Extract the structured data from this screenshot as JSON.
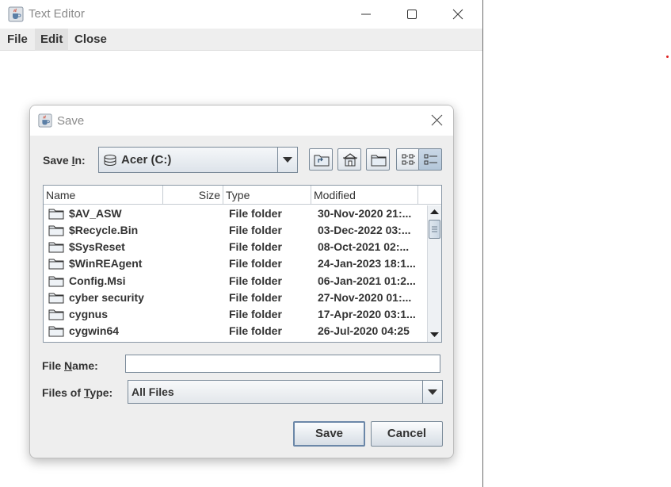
{
  "editor": {
    "title": "Text Editor",
    "menu": {
      "file": "File",
      "edit": "Edit",
      "close": "Close"
    }
  },
  "dialog": {
    "title": "Save",
    "save_in_label_prefix": "Save ",
    "save_in_label_mnemonic": "I",
    "save_in_label_suffix": "n:",
    "save_in_value": "Acer (C:)",
    "columns": {
      "name": "Name",
      "size": "Size",
      "type": "Type",
      "modified": "Modified"
    },
    "files": [
      {
        "name": "$AV_ASW",
        "type": "File folder",
        "modified": "30-Nov-2020 21:..."
      },
      {
        "name": "$Recycle.Bin",
        "type": "File folder",
        "modified": "03-Dec-2022 03:..."
      },
      {
        "name": "$SysReset",
        "type": "File folder",
        "modified": "08-Oct-2021 02:..."
      },
      {
        "name": "$WinREAgent",
        "type": "File folder",
        "modified": "24-Jan-2023 18:1..."
      },
      {
        "name": "Config.Msi",
        "type": "File folder",
        "modified": "06-Jan-2021 01:2..."
      },
      {
        "name": "cyber security",
        "type": "File folder",
        "modified": "27-Nov-2020 01:..."
      },
      {
        "name": "cygnus",
        "type": "File folder",
        "modified": "17-Apr-2020 03:1..."
      },
      {
        "name": "cygwin64",
        "type": "File folder",
        "modified": "26-Jul-2020 04:25"
      }
    ],
    "file_name_label_prefix": "File ",
    "file_name_label_mnemonic": "N",
    "file_name_label_suffix": "ame:",
    "file_name_value": "",
    "file_type_label_prefix": "Files of ",
    "file_type_label_mnemonic": "T",
    "file_type_label_suffix": "ype:",
    "file_type_value": "All Files",
    "save_button": "Save",
    "cancel_button": "Cancel"
  },
  "icons": {
    "app": "java-cup-icon",
    "drive": "hard-drive-icon",
    "folder": "folder-icon",
    "up": "up-folder-icon",
    "home": "home-icon",
    "new_folder": "new-folder-icon",
    "list": "list-view-icon",
    "details": "details-view-icon"
  }
}
